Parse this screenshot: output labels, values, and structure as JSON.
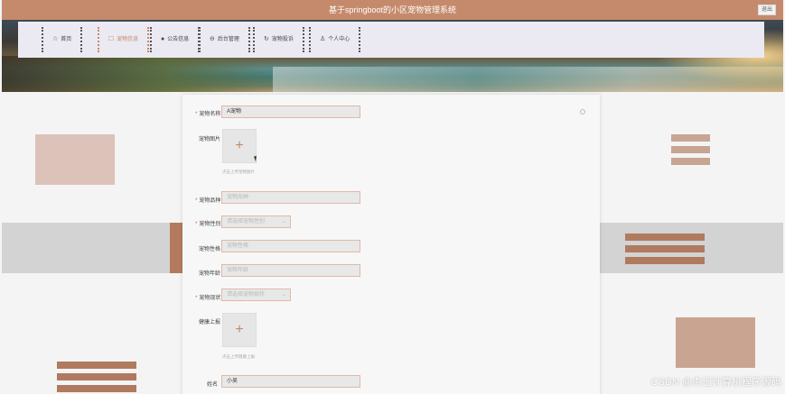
{
  "app": {
    "title": "基于springboot的小区宠物管理系统",
    "exit_label": "退出"
  },
  "nav": {
    "items": [
      {
        "label": "首页",
        "icon": "☆"
      },
      {
        "label": "宠物信息",
        "icon": "☐"
      },
      {
        "label": "公告信息",
        "icon": "●"
      },
      {
        "label": "后台管理",
        "icon": "⊖"
      },
      {
        "label": "宠物投诉",
        "icon": "↻"
      },
      {
        "label": "个人中心",
        "icon": "♙"
      }
    ],
    "active": "宠物信息"
  },
  "form": {
    "pet_name": {
      "label": "宠物名称",
      "value": "A宠物",
      "required": true
    },
    "pet_image": {
      "label": "宠物图片",
      "hint": "点击上传宠物图片"
    },
    "pet_breed": {
      "label": "宠物品种",
      "placeholder": "宠物品种",
      "required": true
    },
    "pet_gender": {
      "label": "宠物性别",
      "placeholder": "请选择宠物性别",
      "required": true
    },
    "pet_personality": {
      "label": "宠物性格",
      "placeholder": "宠物性格"
    },
    "pet_age": {
      "label": "宠物年龄",
      "placeholder": "宠物年龄"
    },
    "pet_status": {
      "label": "宠物现状",
      "placeholder": "请选择宠物现状",
      "required": true
    },
    "health_report": {
      "label": "健康上报",
      "hint": "点击上传健康上报"
    },
    "owner_name": {
      "label": "姓名",
      "value": "小吴"
    }
  },
  "watermark": "CSDN @杰记计算机程序源码",
  "colors": {
    "accent": "#c58a6c",
    "required": "#e05a4a"
  }
}
